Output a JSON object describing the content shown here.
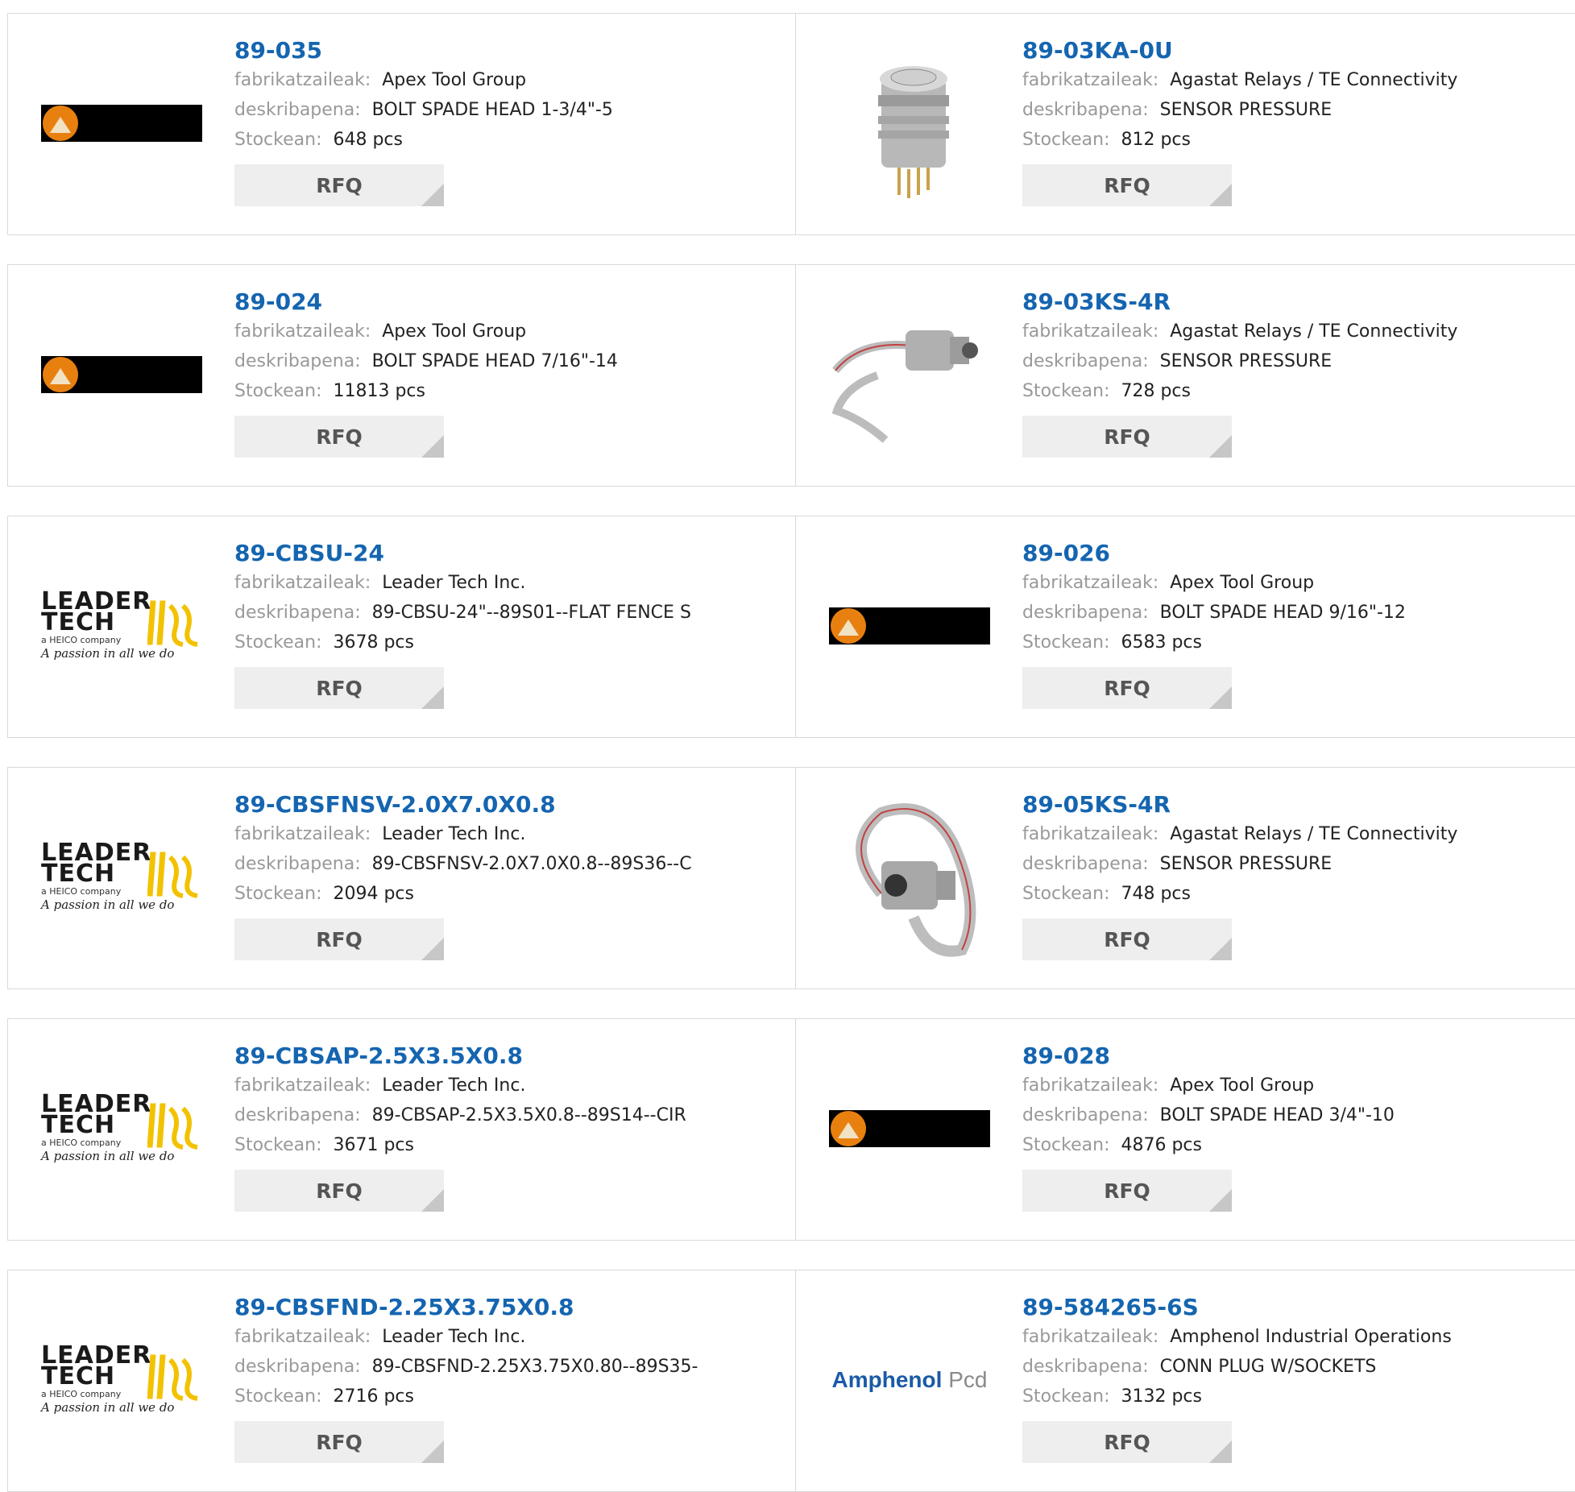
{
  "labels": {
    "manufacturer": "fabrikatzaileak:",
    "description": "deskribapena:",
    "stock": "Stockean:",
    "rfq": "RFQ"
  },
  "logos": {
    "leader_line1": "LEADER",
    "leader_line2": "TECH",
    "leader_sub": "a HEICO company",
    "leader_tag": "A passion in all we do",
    "amphenol_main": "Amphenol",
    "amphenol_pcd": "Pcd"
  },
  "colors": {
    "link": "#1565b0",
    "label": "#999999",
    "button_bg": "#eeeeee",
    "apex_orange": "#e88010"
  },
  "rows": [
    {
      "left": {
        "part": "89-035",
        "manufacturer": "Apex Tool Group",
        "description": "BOLT SPADE HEAD 1-3/4\"-5",
        "stock": "648 pcs",
        "image": "apex-logo"
      },
      "right": {
        "part": "89-03KA-0U",
        "manufacturer": "Agastat Relays / TE Connectivity",
        "description": "SENSOR PRESSURE",
        "stock": "812 pcs",
        "image": "pressure-sensor-pins"
      }
    },
    {
      "left": {
        "part": "89-024",
        "manufacturer": "Apex Tool Group",
        "description": "BOLT SPADE HEAD 7/16\"-14",
        "stock": "11813 pcs",
        "image": "apex-logo"
      },
      "right": {
        "part": "89-03KS-4R",
        "manufacturer": "Agastat Relays / TE Connectivity",
        "description": "SENSOR PRESSURE",
        "stock": "728 pcs",
        "image": "pressure-sensor-cable"
      }
    },
    {
      "left": {
        "part": "89-CBSU-24",
        "manufacturer": "Leader Tech Inc.",
        "description": "89-CBSU-24\"--89S01--FLAT FENCE S",
        "stock": "3678 pcs",
        "image": "leader-tech-logo"
      },
      "right": {
        "part": "89-026",
        "manufacturer": "Apex Tool Group",
        "description": "BOLT SPADE HEAD 9/16\"-12",
        "stock": "6583 pcs",
        "image": "apex-logo"
      }
    },
    {
      "left": {
        "part": "89-CBSFNSV-2.0X7.0X0.8",
        "manufacturer": "Leader Tech Inc.",
        "description": "89-CBSFNSV-2.0X7.0X0.8--89S36--C",
        "stock": "2094 pcs",
        "image": "leader-tech-logo"
      },
      "right": {
        "part": "89-05KS-4R",
        "manufacturer": "Agastat Relays / TE Connectivity",
        "description": "SENSOR PRESSURE",
        "stock": "748 pcs",
        "image": "pressure-sensor-ribbon"
      }
    },
    {
      "left": {
        "part": "89-CBSAP-2.5X3.5X0.8",
        "manufacturer": "Leader Tech Inc.",
        "description": "89-CBSAP-2.5X3.5X0.8--89S14--CIR",
        "stock": "3671 pcs",
        "image": "leader-tech-logo"
      },
      "right": {
        "part": "89-028",
        "manufacturer": "Apex Tool Group",
        "description": "BOLT SPADE HEAD 3/4\"-10",
        "stock": "4876 pcs",
        "image": "apex-logo"
      }
    },
    {
      "left": {
        "part": "89-CBSFND-2.25X3.75X0.8",
        "manufacturer": "Leader Tech Inc.",
        "description": "89-CBSFND-2.25X3.75X0.80--89S35-",
        "stock": "2716 pcs",
        "image": "leader-tech-logo"
      },
      "right": {
        "part": "89-584265-6S",
        "manufacturer": "Amphenol Industrial Operations",
        "description": "CONN PLUG W/SOCKETS",
        "stock": "3132 pcs",
        "image": "amphenol-logo"
      }
    }
  ]
}
